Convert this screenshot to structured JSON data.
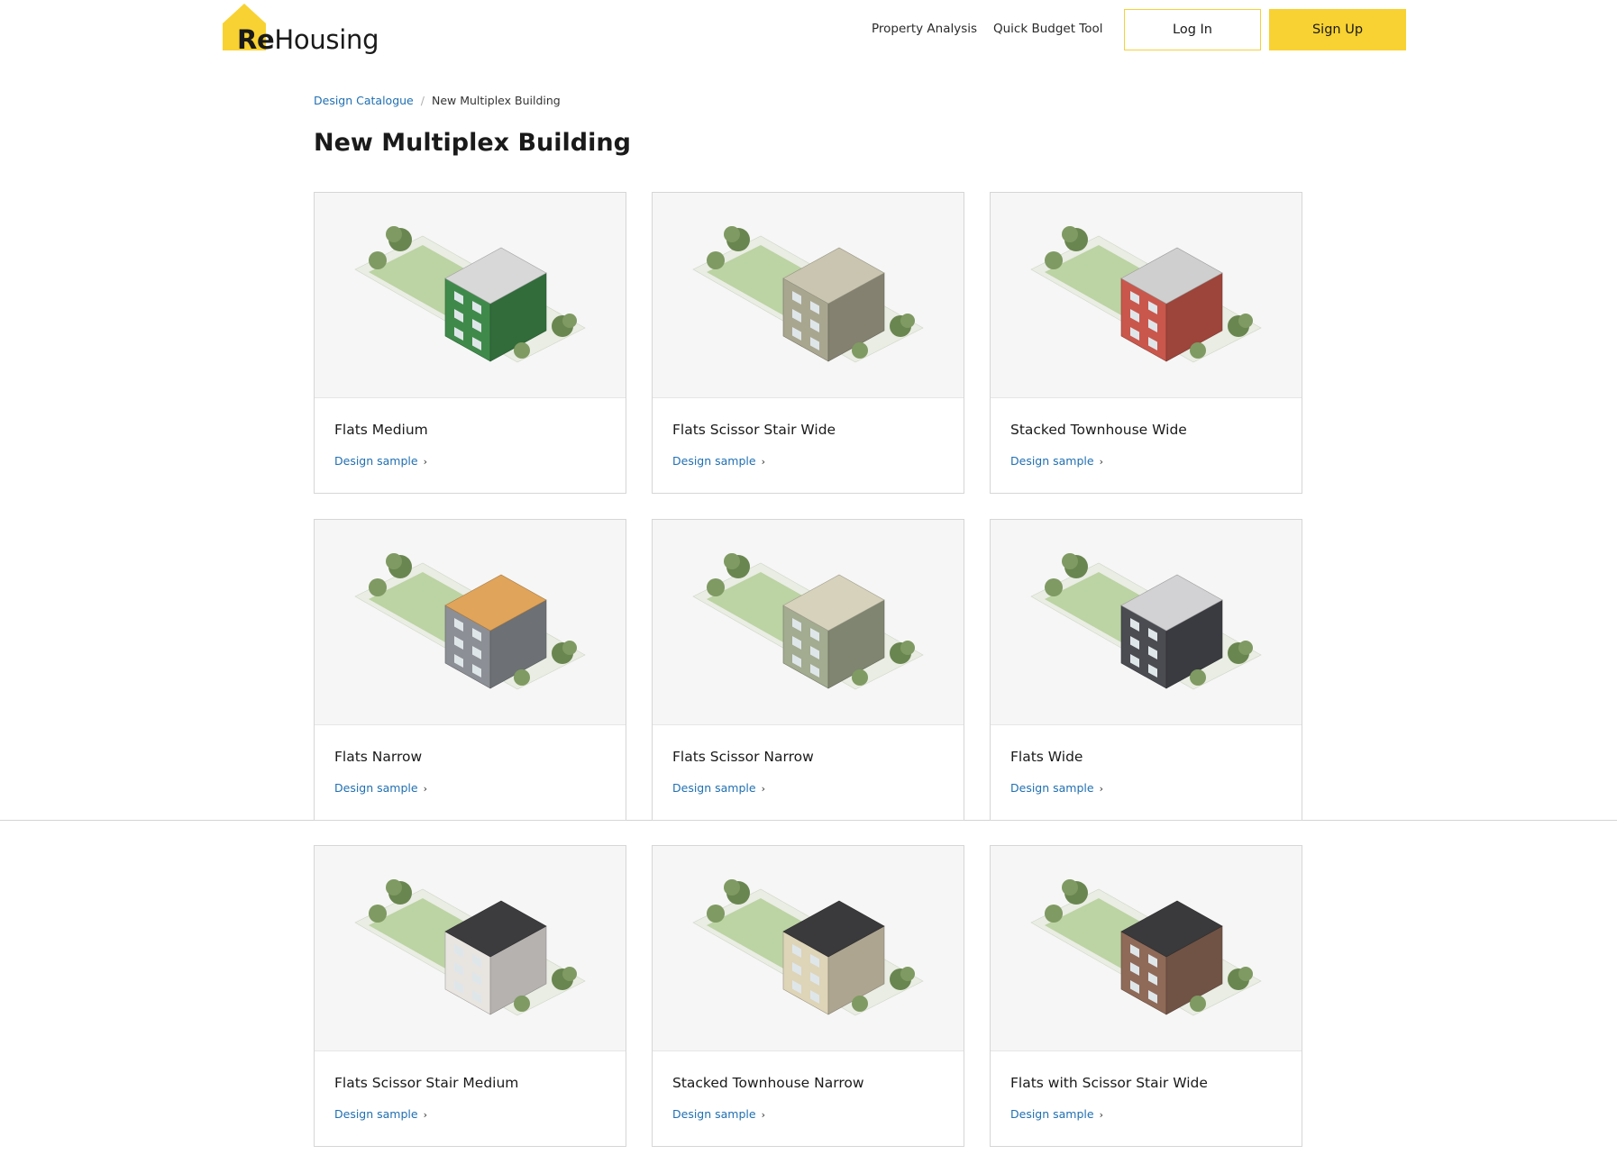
{
  "brand": {
    "logo_prefix": "Re",
    "logo_suffix": "Housing",
    "accent_color": "#f8d232",
    "link_color": "#1f6fb2"
  },
  "nav": {
    "links": [
      "Property Analysis",
      "Quick Budget Tool"
    ],
    "login_label": "Log In",
    "signup_label": "Sign Up"
  },
  "breadcrumb": {
    "parent": "Design Catalogue",
    "separator": "/",
    "current": "New Multiplex Building"
  },
  "page": {
    "title": "New Multiplex Building"
  },
  "cards": [
    {
      "title": "Flats Medium",
      "link": "Design sample",
      "building_color": "#3f8a4a",
      "roof_color": "#d8d8d8",
      "icon": "building-illustration"
    },
    {
      "title": "Flats Scissor Stair Wide",
      "link": "Design sample",
      "building_color": "#a9a690",
      "roof_color": "#c9c5b0",
      "icon": "building-illustration"
    },
    {
      "title": "Stacked Townhouse Wide",
      "link": "Design sample",
      "building_color": "#c9574c",
      "roof_color": "#cfcfcf",
      "icon": "building-illustration"
    },
    {
      "title": "Flats Narrow",
      "link": "Design sample",
      "building_color": "#8c8f95",
      "roof_color": "#e0a45a",
      "icon": "building-illustration"
    },
    {
      "title": "Flats Scissor Narrow",
      "link": "Design sample",
      "building_color": "#a3ab90",
      "roof_color": "#d6d2bc",
      "icon": "building-illustration"
    },
    {
      "title": "Flats Wide",
      "link": "Design sample",
      "building_color": "#4a4c52",
      "roof_color": "#d2d2d4",
      "icon": "building-illustration"
    },
    {
      "title": "Flats Scissor Stair Medium",
      "link": "Design sample",
      "building_color": "#e8e4e0",
      "roof_color": "#3c3c3e",
      "icon": "building-illustration"
    },
    {
      "title": "Stacked Townhouse Narrow",
      "link": "Design sample",
      "building_color": "#ded4b8",
      "roof_color": "#3a3a3c",
      "icon": "building-illustration"
    },
    {
      "title": "Flats with Scissor Stair Wide",
      "link": "Design sample",
      "building_color": "#8f6a58",
      "roof_color": "#3a3a3c",
      "icon": "building-illustration"
    }
  ]
}
